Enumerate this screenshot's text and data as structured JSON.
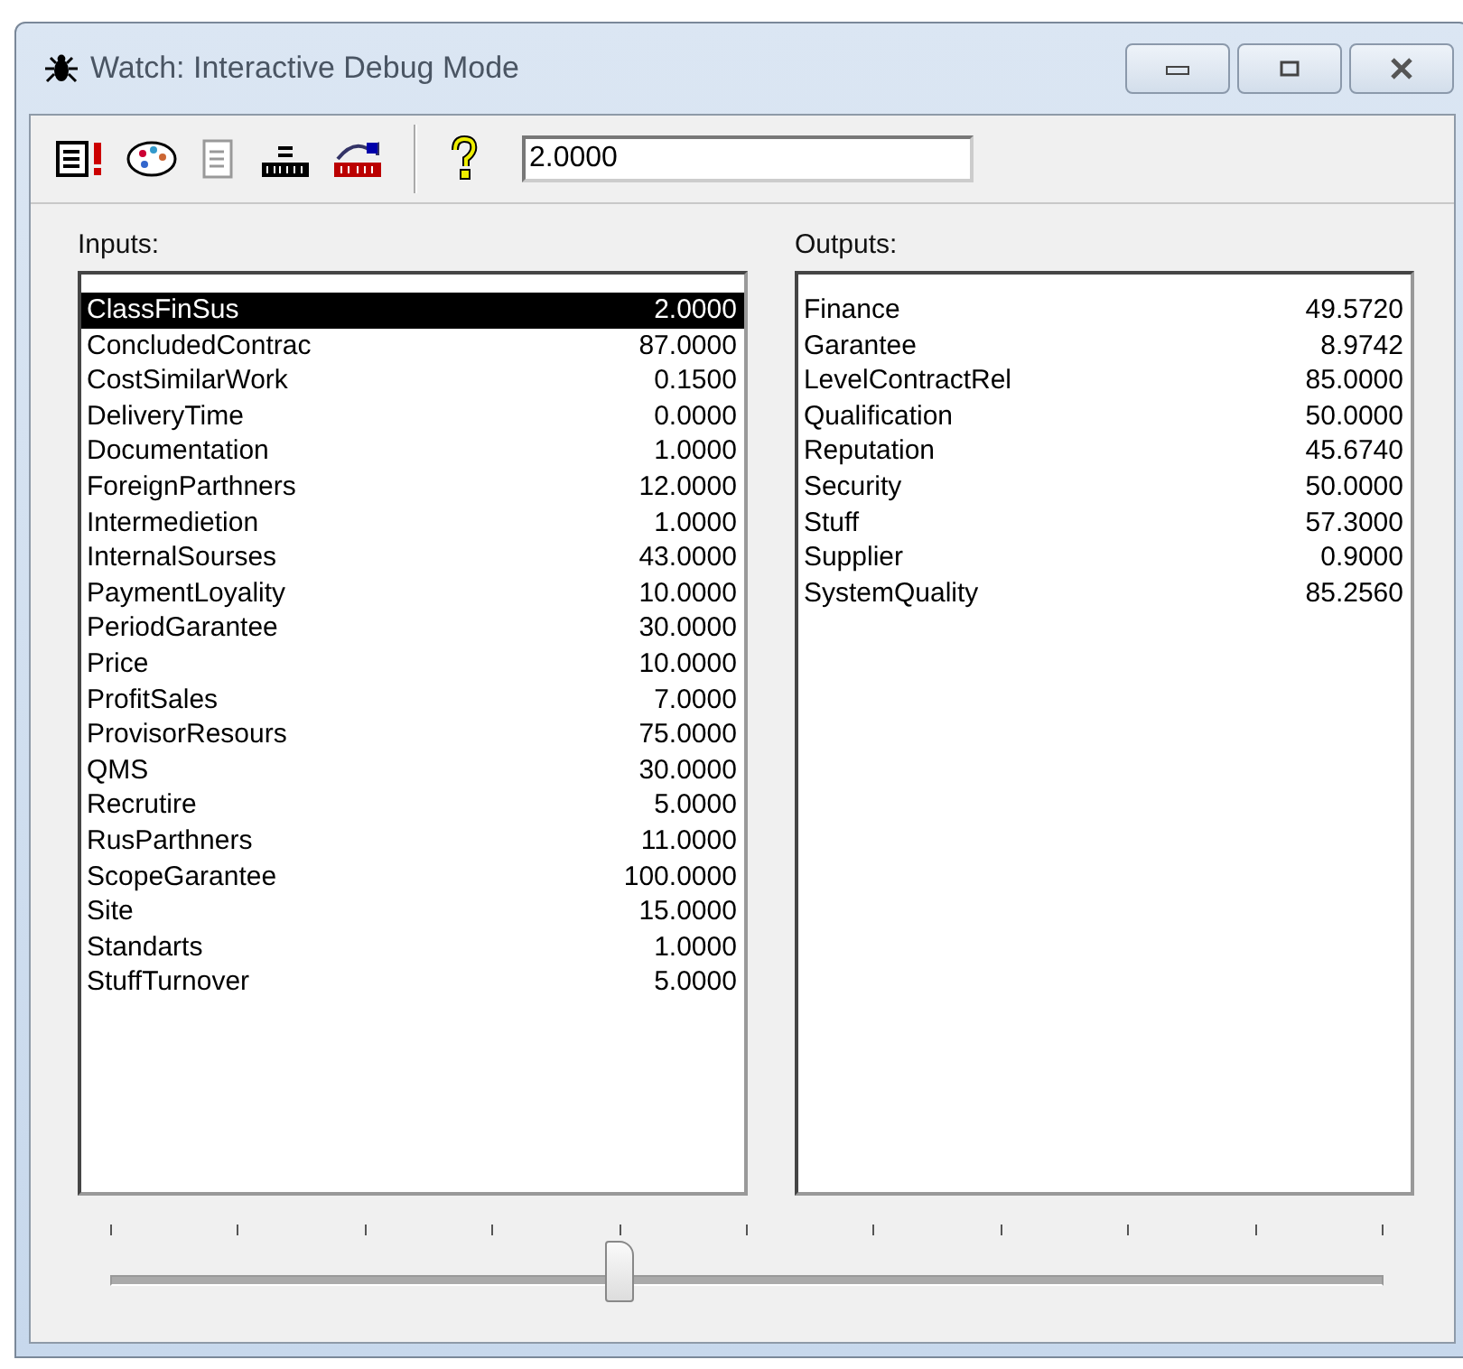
{
  "window": {
    "title": "Watch: Interactive Debug Mode"
  },
  "toolbar": {
    "value_field": "2.0000"
  },
  "inputs": {
    "label": "Inputs:",
    "items": [
      {
        "name": "ClassFinSus",
        "value": "2.0000",
        "selected": true
      },
      {
        "name": "ConcludedContrac",
        "value": "87.0000",
        "selected": false
      },
      {
        "name": "CostSimilarWork",
        "value": "0.1500",
        "selected": false
      },
      {
        "name": "DeliveryTime",
        "value": "0.0000",
        "selected": false
      },
      {
        "name": "Documentation",
        "value": "1.0000",
        "selected": false
      },
      {
        "name": "ForeignParthners",
        "value": "12.0000",
        "selected": false
      },
      {
        "name": "Intermedietion",
        "value": "1.0000",
        "selected": false
      },
      {
        "name": "InternalSourses",
        "value": "43.0000",
        "selected": false
      },
      {
        "name": "PaymentLoyality",
        "value": "10.0000",
        "selected": false
      },
      {
        "name": "PeriodGarantee",
        "value": "30.0000",
        "selected": false
      },
      {
        "name": "Price",
        "value": "10.0000",
        "selected": false
      },
      {
        "name": "ProfitSales",
        "value": "7.0000",
        "selected": false
      },
      {
        "name": "ProvisorResours",
        "value": "75.0000",
        "selected": false
      },
      {
        "name": "QMS",
        "value": "30.0000",
        "selected": false
      },
      {
        "name": "Recrutire",
        "value": "5.0000",
        "selected": false
      },
      {
        "name": "RusParthners",
        "value": "11.0000",
        "selected": false
      },
      {
        "name": "ScopeGarantee",
        "value": "100.0000",
        "selected": false
      },
      {
        "name": "Site",
        "value": "15.0000",
        "selected": false
      },
      {
        "name": "Standarts",
        "value": "1.0000",
        "selected": false
      },
      {
        "name": "StuffTurnover",
        "value": "5.0000",
        "selected": false
      }
    ]
  },
  "outputs": {
    "label": "Outputs:",
    "items": [
      {
        "name": "Finance",
        "value": "49.5720"
      },
      {
        "name": "Garantee",
        "value": "8.9742"
      },
      {
        "name": "LevelContractRel",
        "value": "85.0000"
      },
      {
        "name": "Qualification",
        "value": "50.0000"
      },
      {
        "name": "Reputation",
        "value": "45.6740"
      },
      {
        "name": "Security",
        "value": "50.0000"
      },
      {
        "name": "Stuff",
        "value": "57.3000"
      },
      {
        "name": "Supplier",
        "value": "0.9000"
      },
      {
        "name": "SystemQuality",
        "value": "85.2560"
      }
    ]
  },
  "slider": {
    "level": 0.4
  }
}
